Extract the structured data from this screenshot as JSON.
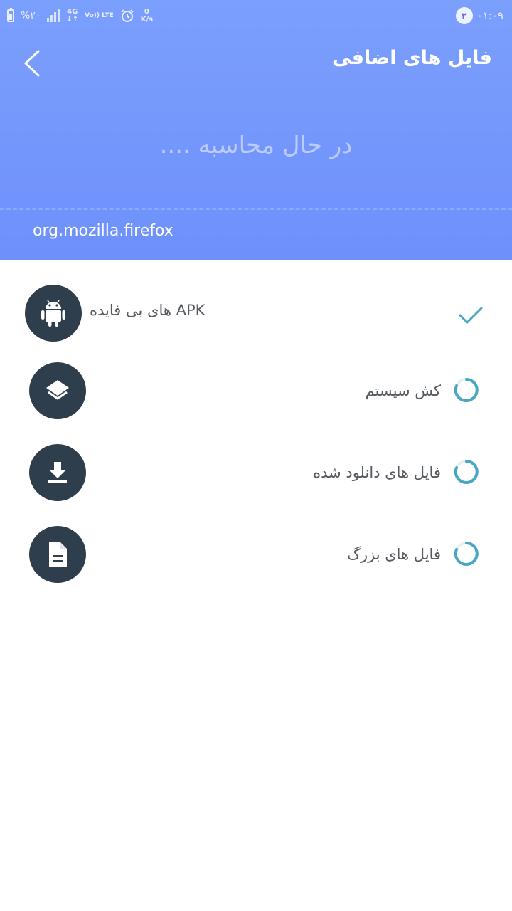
{
  "status_bar": {
    "battery": "%۲۰",
    "network": "4G",
    "volte": "Vo)) LTE",
    "speed_value": "0",
    "speed_unit": "K/s",
    "notification_count": "۲",
    "time": "۰۱:۰۹"
  },
  "header": {
    "title": "فایل های اضافی",
    "calculating_text": "در حال محاسبه ....",
    "package_name": "org.mozilla.firefox",
    "background_color": "#7b9ffd"
  },
  "items": [
    {
      "label": "APK های بی فایده",
      "icon": "android-icon",
      "status": "done"
    },
    {
      "label": "کش سیستم",
      "icon": "layers-icon",
      "status": "loading"
    },
    {
      "label": "فایل های دانلود شده",
      "icon": "download-icon",
      "status": "loading"
    },
    {
      "label": "فایل های بزرگ",
      "icon": "document-icon",
      "status": "loading"
    }
  ],
  "colors": {
    "icon_circle": "#2f3e4c",
    "accent_teal": "#4aa7c4",
    "label_text": "#555a60"
  }
}
